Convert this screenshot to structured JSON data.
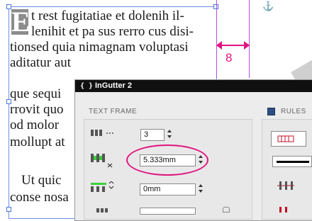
{
  "document": {
    "dropcap": "E",
    "lines": [
      "t rest fugitatiae et dolenih il-",
      "lenihit et pa sus rerro cus disi-",
      "tionsed quia nimagnam voluptasi",
      "aditatur aut",
      "que sequi",
      "rrovit quo",
      "od molor",
      "mollupt at",
      "Ut quic",
      "conse nosa"
    ],
    "gutter_measure": "8"
  },
  "panel": {
    "title": "InGutter 2",
    "collapse_glyph": "{ }",
    "text_frame": {
      "heading": "TEXT FRAME",
      "columns_value": "3",
      "gutter_value": "5.333mm",
      "offset_value": "0mm"
    },
    "rules": {
      "heading": "RULES"
    }
  },
  "colors": {
    "accent": "#e0147e",
    "gutter_guide": "#b14fe0",
    "frame_guide": "#6a8ee6"
  }
}
